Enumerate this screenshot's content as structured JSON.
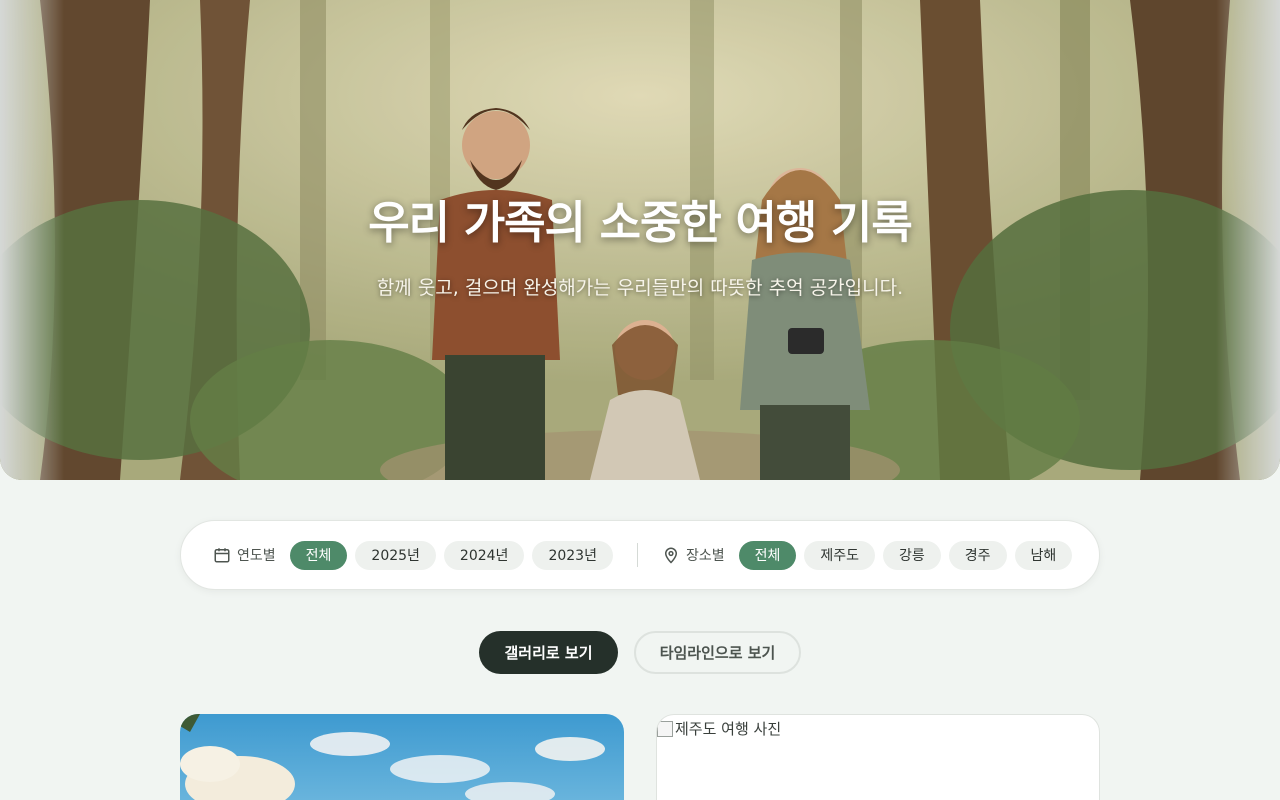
{
  "hero": {
    "title": "우리 가족의 소중한 여행 기록",
    "subtitle": "함께 웃고, 걸으며 완성해가는 우리들만의 따뜻한 추억 공간입니다."
  },
  "filters": {
    "year_label": "연도별",
    "year_options": [
      "전체",
      "2025년",
      "2024년",
      "2023년"
    ],
    "year_selected": "전체",
    "place_label": "장소별",
    "place_options": [
      "전체",
      "제주도",
      "강릉",
      "경주",
      "남해"
    ],
    "place_selected": "전체"
  },
  "view_toggle": {
    "gallery_label": "갤러리로 보기",
    "timeline_label": "타임라인으로 보기",
    "active": "gallery"
  },
  "cards": [
    {
      "image_alt": "",
      "image": "sky-clouds-illustration"
    },
    {
      "image_alt": "제주도 여행 사진",
      "image": "broken-image"
    }
  ],
  "colors": {
    "accent": "#4e8a69",
    "dark_button": "#25302a",
    "background": "#f1f5f2"
  },
  "icons": [
    "calendar-icon",
    "map-pin-icon"
  ]
}
